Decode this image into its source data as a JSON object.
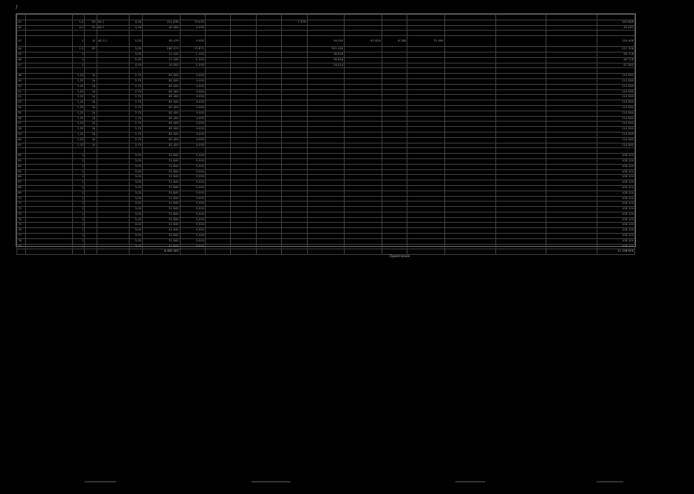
{
  "page": {
    "mark": "/"
  },
  "table": {
    "rows": [
      {
        "n": "",
        "name": "",
        "q": "",
        "m": "",
        "c": "",
        "t": "",
        "v": [
          "",
          "",
          "",
          "",
          "",
          "",
          "",
          "",
          "",
          "",
          "",
          "",
          "",
          ""
        ]
      },
      {
        "n": "41",
        "name": "",
        "q": "1,6",
        "m": "50",
        "c": "64-1",
        "t": "4,26",
        "v": [
          "251 838",
          "79 020",
          "",
          "",
          "",
          "7 878",
          "",
          "",
          "",
          "",
          "",
          "",
          "",
          "263 868"
        ]
      },
      {
        "n": "42",
        "name": "",
        "q": "0,5",
        "m": "25",
        "c": "64-1",
        "t": "4,26",
        "v": [
          "40 064",
          "4 000",
          "",
          "",
          "",
          "",
          "",
          "",
          "",
          "",
          "",
          "",
          "",
          "40 064"
        ]
      },
      {
        "n": "",
        "name": "",
        "q": "",
        "m": "",
        "c": "",
        "t": "",
        "v": [
          "",
          "",
          "",
          "",
          "",
          "",
          "",
          "",
          "",
          "",
          "",
          "",
          "",
          ""
        ]
      },
      {
        "n": "43",
        "name": "",
        "q": "1",
        "m": "14",
        "c": "АБ-3-1",
        "t": "5,00",
        "v": [
          "98 476",
          "4 000",
          "",
          "",
          "",
          "",
          "54 000",
          "63 828",
          "6 288",
          "75 296",
          "",
          "",
          "",
          "139 406"
        ],
        "tall": true
      },
      {
        "n": "44",
        "name": "",
        "q": "1,5",
        "m": "50",
        "c": "",
        "t": "5,00",
        "v": [
          "180 071",
          "13 871",
          "",
          "",
          "",
          "",
          "351 400",
          "",
          "",
          "",
          "",
          "",
          "",
          "211 158"
        ]
      },
      {
        "n": "45",
        "name": "",
        "q": "1",
        "m": "",
        "c": "",
        "t": "5,00",
        "v": [
          "21 345",
          "1 500",
          "",
          "",
          "",
          "",
          "28 818",
          "",
          "",
          "",
          "",
          "",
          "",
          "69 718"
        ]
      },
      {
        "n": "46",
        "name": "",
        "q": "1",
        "m": "",
        "c": "",
        "t": "5,00",
        "v": [
          "21 345",
          "1 500",
          "",
          "",
          "",
          "",
          "28 818",
          "",
          "",
          "",
          "",
          "",
          "",
          "69 718"
        ]
      },
      {
        "n": "47",
        "name": "",
        "q": "1",
        "m": "",
        "c": "",
        "t": "4,39",
        "v": [
          "19 000",
          "1 000",
          "",
          "",
          "",
          "",
          "24 614",
          "",
          "",
          "",
          "",
          "",
          "",
          "67 580"
        ]
      },
      {
        "n": "",
        "name": "",
        "q": "",
        "m": "",
        "c": "",
        "t": "",
        "v": [
          "",
          "",
          "",
          "",
          "",
          "",
          "",
          "",
          "",
          "",
          "",
          "",
          "",
          ""
        ]
      },
      {
        "n": "48",
        "name": "",
        "q": "1,25",
        "m": "14",
        "c": "",
        "t": "2,70",
        "v": [
          "65 400",
          "4 000",
          "",
          "",
          "",
          "",
          "",
          "",
          "",
          "",
          "",
          "",
          "",
          "110 560"
        ]
      },
      {
        "n": "49",
        "name": "",
        "q": "1,25",
        "m": "14",
        "c": "",
        "t": "2,70",
        "v": [
          "65 400",
          "4 000",
          "",
          "",
          "",
          "",
          "",
          "",
          "",
          "",
          "",
          "",
          "",
          "110 560"
        ]
      },
      {
        "n": "50",
        "name": "",
        "q": "1,25",
        "m": "14",
        "c": "",
        "t": "2,70",
        "v": [
          "65 400",
          "4 000",
          "",
          "",
          "",
          "",
          "",
          "",
          "",
          "",
          "",
          "",
          "",
          "110 560"
        ]
      },
      {
        "n": "51",
        "name": "",
        "q": "1,25",
        "m": "14",
        "c": "",
        "t": "2,70",
        "v": [
          "65 400",
          "4 000",
          "",
          "",
          "",
          "",
          "",
          "",
          "",
          "",
          "",
          "",
          "",
          "110 560"
        ]
      },
      {
        "n": "52",
        "name": "",
        "q": "1,25",
        "m": "14",
        "c": "",
        "t": "2,70",
        "v": [
          "65 400",
          "4 000",
          "",
          "",
          "",
          "",
          "",
          "",
          "",
          "",
          "",
          "",
          "",
          "110 560"
        ]
      },
      {
        "n": "53",
        "name": "",
        "q": "1,25",
        "m": "14",
        "c": "",
        "t": "2,70",
        "v": [
          "65 400",
          "4 000",
          "",
          "",
          "",
          "",
          "",
          "",
          "",
          "",
          "",
          "",
          "",
          "110 560"
        ]
      },
      {
        "n": "54",
        "name": "",
        "q": "1,25",
        "m": "14",
        "c": "",
        "t": "2,70",
        "v": [
          "65 400",
          "4 000",
          "",
          "",
          "",
          "",
          "",
          "",
          "",
          "",
          "",
          "",
          "",
          "110 560"
        ]
      },
      {
        "n": "55",
        "name": "",
        "q": "1,25",
        "m": "14",
        "c": "",
        "t": "2,70",
        "v": [
          "65 400",
          "4 000",
          "",
          "",
          "",
          "",
          "",
          "",
          "",
          "",
          "",
          "",
          "",
          "110 560"
        ]
      },
      {
        "n": "56",
        "name": "",
        "q": "1,25",
        "m": "14",
        "c": "",
        "t": "2,70",
        "v": [
          "65 400",
          "4 000",
          "",
          "",
          "",
          "",
          "",
          "",
          "",
          "",
          "",
          "",
          "",
          "110 560"
        ]
      },
      {
        "n": "57",
        "name": "",
        "q": "1,25",
        "m": "14",
        "c": "",
        "t": "2,70",
        "v": [
          "65 400",
          "4 000",
          "",
          "",
          "",
          "",
          "",
          "",
          "",
          "",
          "",
          "",
          "",
          "110 560"
        ]
      },
      {
        "n": "58",
        "name": "",
        "q": "1,25",
        "m": "14",
        "c": "",
        "t": "2,70",
        "v": [
          "65 400",
          "4 000",
          "",
          "",
          "",
          "",
          "",
          "",
          "",
          "",
          "",
          "",
          "",
          "110 560"
        ]
      },
      {
        "n": "59",
        "name": "",
        "q": "1,25",
        "m": "14",
        "c": "",
        "t": "2,70",
        "v": [
          "65 400",
          "4 000",
          "",
          "",
          "",
          "",
          "",
          "",
          "",
          "",
          "",
          "",
          "",
          "110 560"
        ]
      },
      {
        "n": "60",
        "name": "",
        "q": "1,25",
        "m": "14",
        "c": "",
        "t": "2,70",
        "v": [
          "65 400",
          "4 000",
          "",
          "",
          "",
          "",
          "",
          "",
          "",
          "",
          "",
          "",
          "",
          "110 560"
        ]
      },
      {
        "n": "61",
        "name": "",
        "q": "1,25",
        "m": "14",
        "c": "",
        "t": "2,70",
        "v": [
          "65 400",
          "4 000",
          "",
          "",
          "",
          "",
          "",
          "",
          "",
          "",
          "",
          "",
          "",
          "110 560"
        ]
      },
      {
        "n": "",
        "name": "",
        "q": "",
        "m": "",
        "c": "",
        "t": "",
        "v": [
          "",
          "",
          "",
          "",
          "",
          "",
          "",
          "",
          "",
          "",
          "",
          "",
          "",
          ""
        ]
      },
      {
        "n": "62",
        "name": "",
        "q": "1",
        "m": "",
        "c": "",
        "t": "3,00",
        "v": [
          "51 840",
          "5 000",
          "",
          "",
          "",
          "",
          "",
          "",
          "",
          "",
          "",
          "",
          "",
          "108 104"
        ]
      },
      {
        "n": "63",
        "name": "",
        "q": "1",
        "m": "",
        "c": "",
        "t": "3,00",
        "v": [
          "51 840",
          "5 000",
          "",
          "",
          "",
          "",
          "",
          "",
          "",
          "",
          "",
          "",
          "",
          "108 104"
        ]
      },
      {
        "n": "64",
        "name": "",
        "q": "1",
        "m": "",
        "c": "",
        "t": "3,00",
        "v": [
          "51 840",
          "5 000",
          "",
          "",
          "",
          "",
          "",
          "",
          "",
          "",
          "",
          "",
          "",
          "108 104"
        ]
      },
      {
        "n": "65",
        "name": "",
        "q": "1",
        "m": "",
        "c": "",
        "t": "3,00",
        "v": [
          "51 840",
          "5 000",
          "",
          "",
          "",
          "",
          "",
          "",
          "",
          "",
          "",
          "",
          "",
          "108 104"
        ]
      },
      {
        "n": "66",
        "name": "",
        "q": "1",
        "m": "",
        "c": "",
        "t": "3,00",
        "v": [
          "51 840",
          "5 000",
          "",
          "",
          "",
          "",
          "",
          "",
          "",
          "",
          "",
          "",
          "",
          "108 104"
        ]
      },
      {
        "n": "67",
        "name": "",
        "q": "1",
        "m": "",
        "c": "",
        "t": "3,00",
        "v": [
          "51 840",
          "5 000",
          "",
          "",
          "",
          "",
          "",
          "",
          "",
          "",
          "",
          "",
          "",
          "108 104"
        ]
      },
      {
        "n": "68",
        "name": "",
        "q": "1",
        "m": "",
        "c": "",
        "t": "3,00",
        "v": [
          "51 840",
          "5 000",
          "",
          "",
          "",
          "",
          "",
          "",
          "",
          "",
          "",
          "",
          "",
          "108 104"
        ]
      },
      {
        "n": "69",
        "name": "",
        "q": "1",
        "m": "",
        "c": "",
        "t": "3,00",
        "v": [
          "51 840",
          "5 000",
          "",
          "",
          "",
          "",
          "",
          "",
          "",
          "",
          "",
          "",
          "",
          "108 104"
        ]
      },
      {
        "n": "70",
        "name": "",
        "q": "1",
        "m": "",
        "c": "",
        "t": "3,00",
        "v": [
          "51 840",
          "5 000",
          "",
          "",
          "",
          "",
          "",
          "",
          "",
          "",
          "",
          "",
          "",
          "108 104"
        ]
      },
      {
        "n": "71",
        "name": "",
        "q": "1",
        "m": "",
        "c": "",
        "t": "3,00",
        "v": [
          "51 840",
          "5 000",
          "",
          "",
          "",
          "",
          "",
          "",
          "",
          "",
          "",
          "",
          "",
          "108 104"
        ]
      },
      {
        "n": "72",
        "name": "",
        "q": "1",
        "m": "",
        "c": "",
        "t": "3,00",
        "v": [
          "51 840",
          "5 000",
          "",
          "",
          "",
          "",
          "",
          "",
          "",
          "",
          "",
          "",
          "",
          "108 104"
        ]
      },
      {
        "n": "73",
        "name": "",
        "q": "1",
        "m": "",
        "c": "",
        "t": "3,00",
        "v": [
          "51 840",
          "5 000",
          "",
          "",
          "",
          "",
          "",
          "",
          "",
          "",
          "",
          "",
          "",
          "108 104"
        ]
      },
      {
        "n": "74",
        "name": "",
        "q": "1",
        "m": "",
        "c": "",
        "t": "3,00",
        "v": [
          "51 840",
          "5 000",
          "",
          "",
          "",
          "",
          "",
          "",
          "",
          "",
          "",
          "",
          "",
          "108 104"
        ]
      },
      {
        "n": "75",
        "name": "",
        "q": "1",
        "m": "",
        "c": "",
        "t": "3,00",
        "v": [
          "51 840",
          "5 000",
          "",
          "",
          "",
          "",
          "",
          "",
          "",
          "",
          "",
          "",
          "",
          "108 104"
        ]
      },
      {
        "n": "76",
        "name": "",
        "q": "1",
        "m": "",
        "c": "",
        "t": "3,00",
        "v": [
          "51 840",
          "5 000",
          "",
          "",
          "",
          "",
          "",
          "",
          "",
          "",
          "",
          "",
          "",
          "108 104"
        ]
      },
      {
        "n": "77",
        "name": "",
        "q": "1",
        "m": "",
        "c": "",
        "t": "3,00",
        "v": [
          "51 840",
          "5 000",
          "",
          "",
          "",
          "",
          "",
          "",
          "",
          "",
          "",
          "",
          "",
          "108 104"
        ]
      },
      {
        "n": "78",
        "name": "",
        "q": "1",
        "m": "",
        "c": "",
        "t": "3,00",
        "v": [
          "51 840",
          "5 000",
          "",
          "",
          "",
          "",
          "",
          "",
          "",
          "",
          "",
          "",
          "",
          "108 104"
        ]
      },
      {
        "n": "79",
        "name": "",
        "q": "1",
        "m": "",
        "c": "",
        "t": "3,00",
        "v": [
          "51 840",
          "5 000",
          "",
          "",
          "",
          "",
          "",
          "",
          "",
          "",
          "",
          "",
          "",
          "108 104"
        ]
      }
    ],
    "total": {
      "n": "",
      "name": "",
      "q": "",
      "m": "",
      "c": "",
      "t": "",
      "v": [
        "6 459 303",
        "",
        "",
        "",
        "",
        "",
        "",
        "",
        "",
        "",
        "",
        "",
        "",
        "11 198 950"
      ]
    }
  },
  "note": {
    "line1": "Примечание",
    "line2": "",
    "line3": ""
  },
  "footer": {
    "l1": "",
    "l2": "",
    "l3": "",
    "l4": ""
  }
}
